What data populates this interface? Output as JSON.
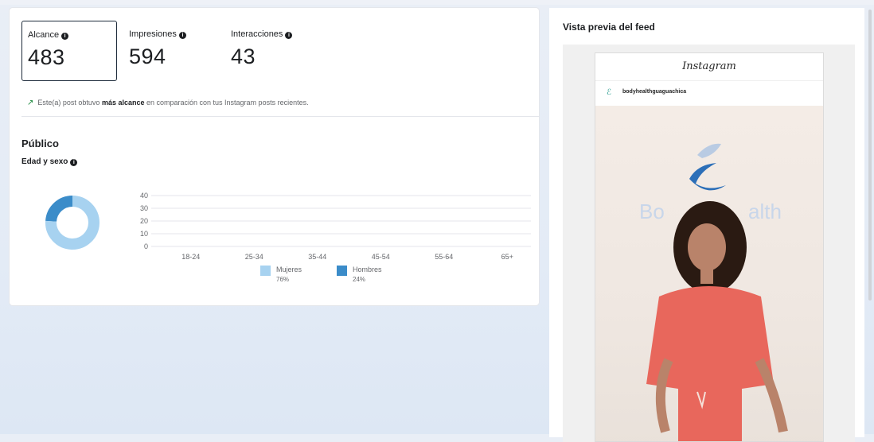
{
  "metrics": [
    {
      "label": "Alcance",
      "value": "483"
    },
    {
      "label": "Impresiones",
      "value": "594"
    },
    {
      "label": "Interacciones",
      "value": "43"
    }
  ],
  "insight": {
    "prefix": "Este(a) post obtuvo ",
    "bold": "más alcance",
    "suffix": " en comparación con tus Instagram posts recientes."
  },
  "audience": {
    "title": "Público",
    "subtitle": "Edad y sexo"
  },
  "chart_data": {
    "type": "bar",
    "categories": [
      "18-24",
      "25-34",
      "35-44",
      "45-54",
      "55-64",
      "65+"
    ],
    "series": [
      {
        "name": "Mujeres",
        "values": [
          0,
          0,
          0,
          0,
          0,
          0
        ],
        "color": "#a7d2f0"
      },
      {
        "name": "Hombres",
        "values": [
          0,
          0,
          0,
          0,
          0,
          0
        ],
        "color": "#3b8cc9"
      }
    ],
    "yticks": [
      "40",
      "30",
      "20",
      "10",
      "0"
    ],
    "ylim": [
      0,
      40
    ],
    "grid": true,
    "donut": [
      {
        "name": "Mujeres",
        "value": 76,
        "color": "#a7d2f0"
      },
      {
        "name": "Hombres",
        "value": 24,
        "color": "#3b8cc9"
      }
    ],
    "legend": [
      {
        "name": "Mujeres",
        "pct": "76%",
        "color": "#a7d2f0"
      },
      {
        "name": "Hombres",
        "pct": "24%",
        "color": "#3b8cc9"
      }
    ]
  },
  "preview": {
    "title": "Vista previa del feed",
    "app_name": "Instagram",
    "username": "bodyhealthguaguachica"
  },
  "colors": {
    "accent": "#3b8cc9",
    "light": "#a7d2f0",
    "trend": "#1c8a3d"
  }
}
